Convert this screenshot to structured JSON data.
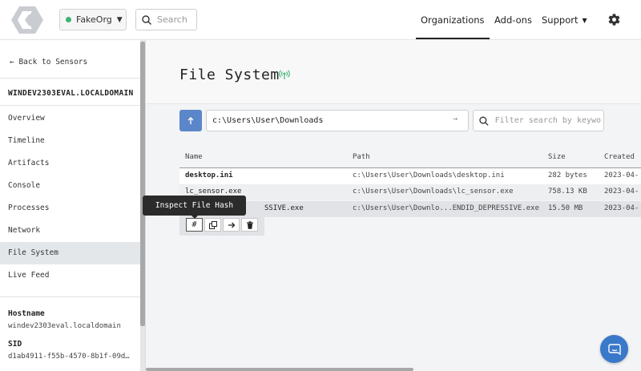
{
  "topbar": {
    "org_name": "FakeOrg",
    "org_status_color": "#3cb371",
    "search_placeholder": "Search",
    "nav": {
      "organizations": "Organizations",
      "addons": "Add-ons",
      "support": "Support"
    },
    "icons": [
      "limacharlie-logo",
      "search-icon",
      "chevron-down-icon",
      "gear-icon"
    ]
  },
  "sidebar": {
    "back_label": "← Back to Sensors",
    "host_title": "WINDEV2303EVAL.LOCALDOMAIN",
    "items": [
      {
        "label": "Overview"
      },
      {
        "label": "Timeline"
      },
      {
        "label": "Artifacts"
      },
      {
        "label": "Console"
      },
      {
        "label": "Processes"
      },
      {
        "label": "Network"
      },
      {
        "label": "File System",
        "active": true
      },
      {
        "label": "Live Feed"
      }
    ],
    "hostname_label": "Hostname",
    "hostname_value": "windev2303eval.localdomain",
    "sid_label": "SID",
    "sid_value": "d1ab4911-f55b-4570-8b1f-09d…"
  },
  "main": {
    "title": "File System",
    "path_value": "c:\\Users\\User\\Downloads",
    "filter_placeholder": "Filter search by keywo",
    "accent_color": "#5b86c9",
    "table": {
      "headers": {
        "name": "Name",
        "path": "Path",
        "size": "Size",
        "created": "Created"
      },
      "rows": [
        {
          "name": "desktop.ini",
          "path": "c:\\Users\\User\\Downloads\\desktop.ini",
          "size": "282 bytes",
          "created": "2023-04-"
        },
        {
          "name": "lc_sensor.exe",
          "path": "c:\\Users\\User\\Downloads\\lc_sensor.exe",
          "size": "758.13 KB",
          "created": "2023-04-"
        },
        {
          "name": "SSIVE.exe",
          "path": "c:\\Users\\User\\Downlo...ENDID_DEPRESSIVE.exe",
          "size": "15.50 MB",
          "created": "2023-04-"
        }
      ]
    },
    "tooltip": "Inspect File Hash",
    "actions": {
      "hash": "#"
    }
  }
}
